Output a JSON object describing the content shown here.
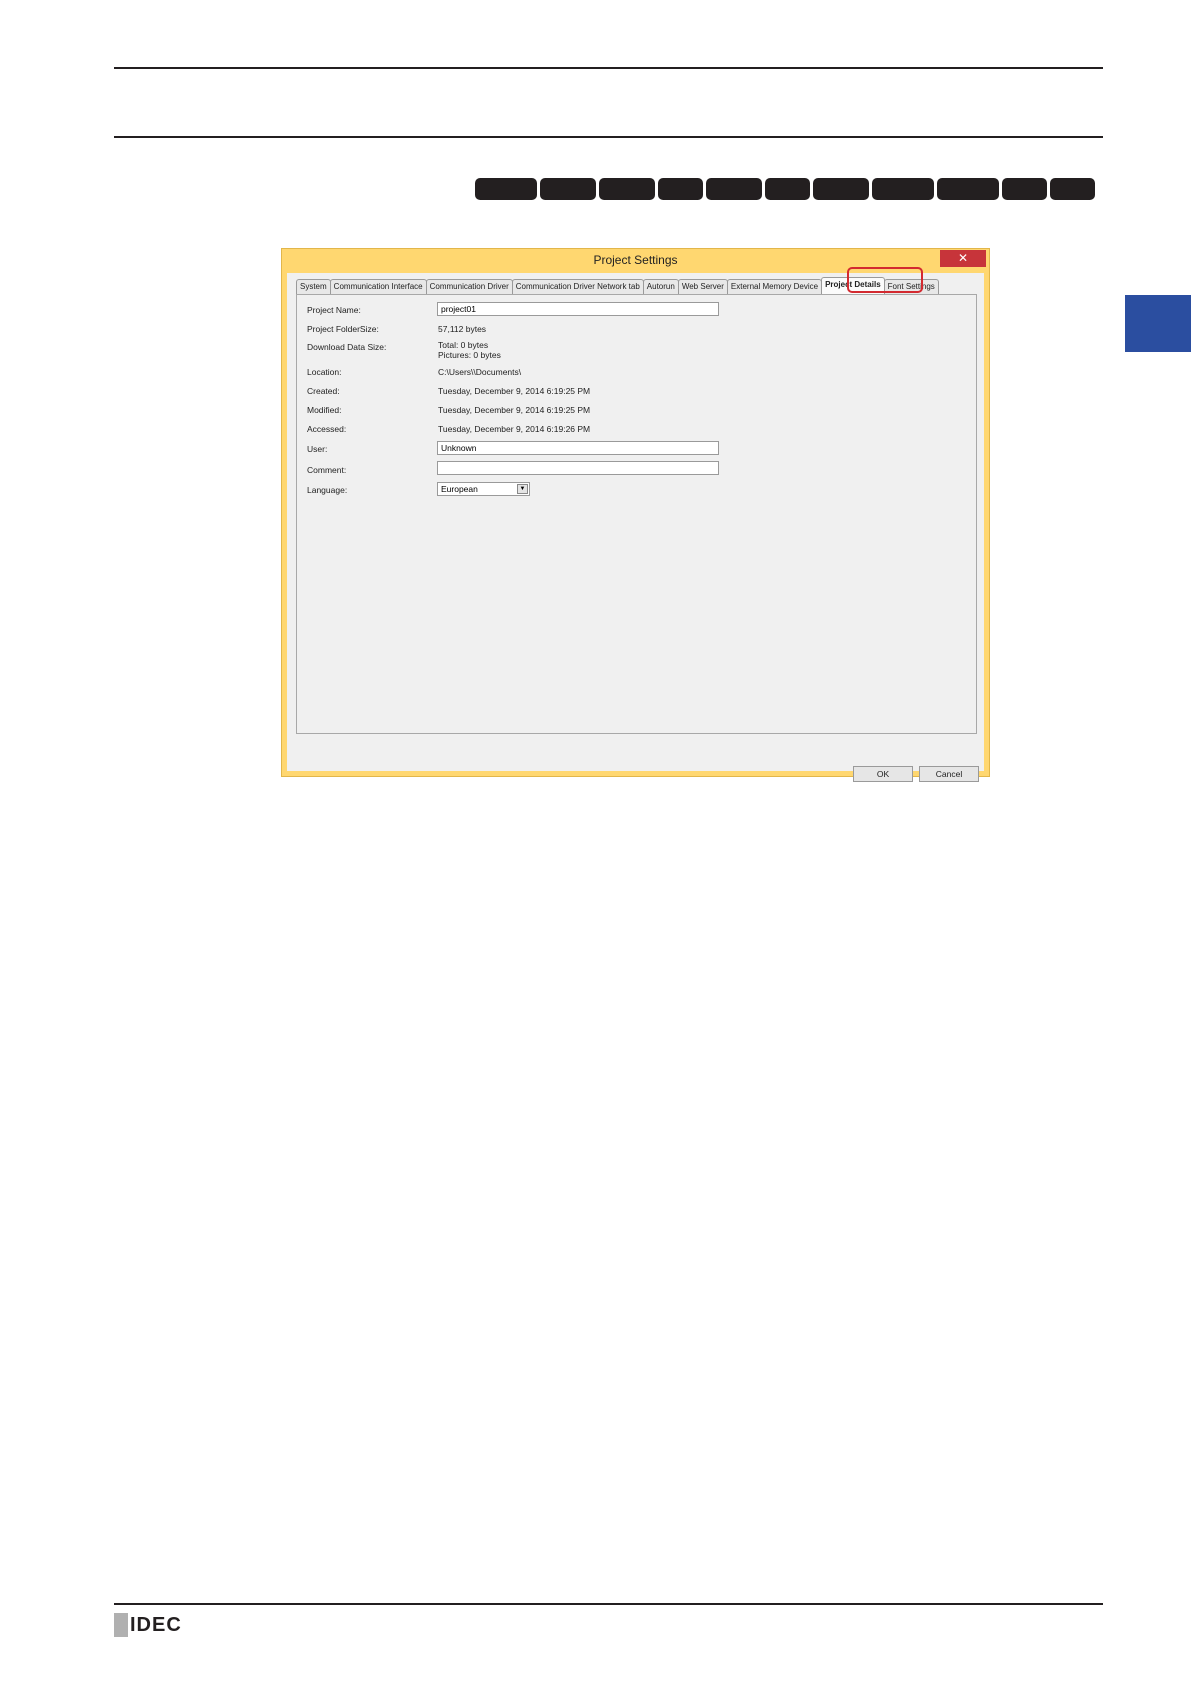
{
  "dialog": {
    "title": "Project Settings",
    "help": "?",
    "close": "✕",
    "tabs": [
      {
        "label": "System"
      },
      {
        "label": "Communication Interface"
      },
      {
        "label": "Communication Driver"
      },
      {
        "label": "Communication Driver Network tab"
      },
      {
        "label": "Autorun"
      },
      {
        "label": "Web Server"
      },
      {
        "label": "External Memory Device"
      },
      {
        "label": "Project Details",
        "active": true
      },
      {
        "label": "Font Settings"
      }
    ],
    "fields": {
      "project_name_label": "Project Name:",
      "project_name_value": "project01",
      "folder_size_label": "Project FolderSize:",
      "folder_size_value": "57,112 bytes",
      "download_size_label": "Download Data Size:",
      "download_total": "Total: 0 bytes",
      "download_pictures": "Pictures: 0 bytes",
      "location_label": "Location:",
      "location_value": "C:\\Users\\\\Documents\\",
      "created_label": "Created:",
      "created_value": "Tuesday, December 9, 2014 6:19:25 PM",
      "modified_label": "Modified:",
      "modified_value": "Tuesday, December 9, 2014 6:19:25 PM",
      "accessed_label": "Accessed:",
      "accessed_value": "Tuesday, December 9, 2014 6:19:26 PM",
      "user_label": "User:",
      "user_value": "Unknown",
      "comment_label": "Comment:",
      "comment_value": "",
      "language_label": "Language:",
      "language_value": "European"
    },
    "buttons": {
      "ok": "OK",
      "cancel": "Cancel"
    }
  },
  "footer": {
    "logo": "IDEC"
  },
  "colors": {
    "side_tab": "#2b4ea0",
    "highlight": "#d32a30",
    "dialog_frame": "#ffd770"
  }
}
